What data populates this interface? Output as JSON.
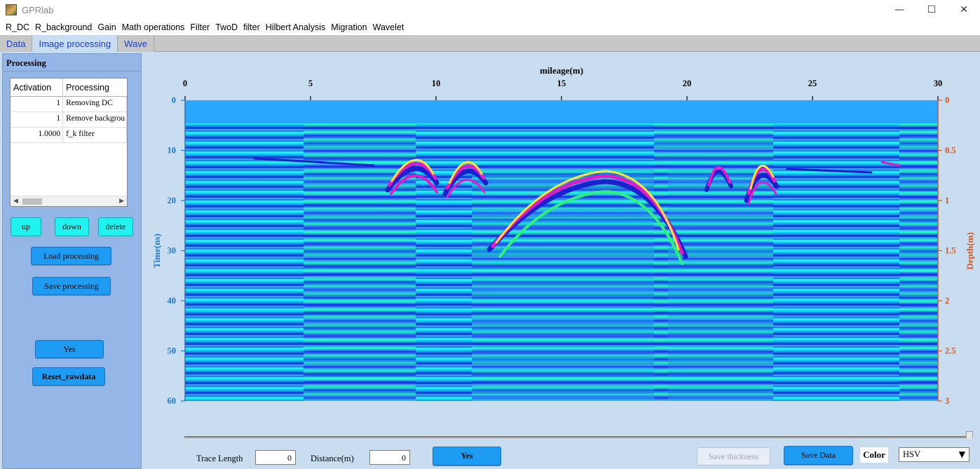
{
  "window": {
    "title": "GPRlab",
    "minimize": "—",
    "maximize": "☐",
    "close": "✕"
  },
  "menu": [
    "R_DC",
    "R_background",
    "Gain",
    "Math operations",
    "Filter",
    "TwoD",
    "filter",
    "Hilbert Analysis",
    "Migration",
    "Wavelet"
  ],
  "tabs": [
    {
      "label": "Data",
      "active": false
    },
    {
      "label": "Image processing",
      "active": true
    },
    {
      "label": "Wave",
      "active": false
    }
  ],
  "panel": {
    "title": "Processing",
    "table": {
      "columns": [
        "Activation",
        "Processing"
      ],
      "rows": [
        {
          "activation": "1",
          "processing": "Removing DC"
        },
        {
          "activation": "1",
          "processing": "Remove backgrou"
        },
        {
          "activation": "1.0000",
          "processing": "f_k filter"
        }
      ]
    },
    "buttons": {
      "up": "up",
      "down": "down",
      "delete": "delete",
      "load": "Load processing",
      "save": "Save processing",
      "yes": "Yes",
      "reset": "Reset_rawdata"
    }
  },
  "plot": {
    "title": "mileage(m)",
    "left_axis_label": "Time(ns)",
    "right_axis_label": "Depth(m)",
    "x_ticks": [
      "0",
      "5",
      "10",
      "15",
      "20",
      "25",
      "30"
    ],
    "y_ticks": [
      "0",
      "10",
      "20",
      "30",
      "40",
      "50",
      "60"
    ],
    "depth_ticks": [
      "0",
      "0.5",
      "1",
      "1.5",
      "2",
      "2.5",
      "3"
    ],
    "colormap": "HSV",
    "left_axis_color": "#1f78c8",
    "right_axis_color": "#d4541a"
  },
  "bottom": {
    "trace_length_label": "Trace Length",
    "trace_length_value": "0",
    "distance_label": "Distance(m)",
    "distance_value": "0",
    "yes": "Yes",
    "save_thickness": "Save thickness",
    "save_data": "Save Data",
    "color_label": "Color",
    "color_value": "HSV",
    "color_caret": "▼"
  }
}
